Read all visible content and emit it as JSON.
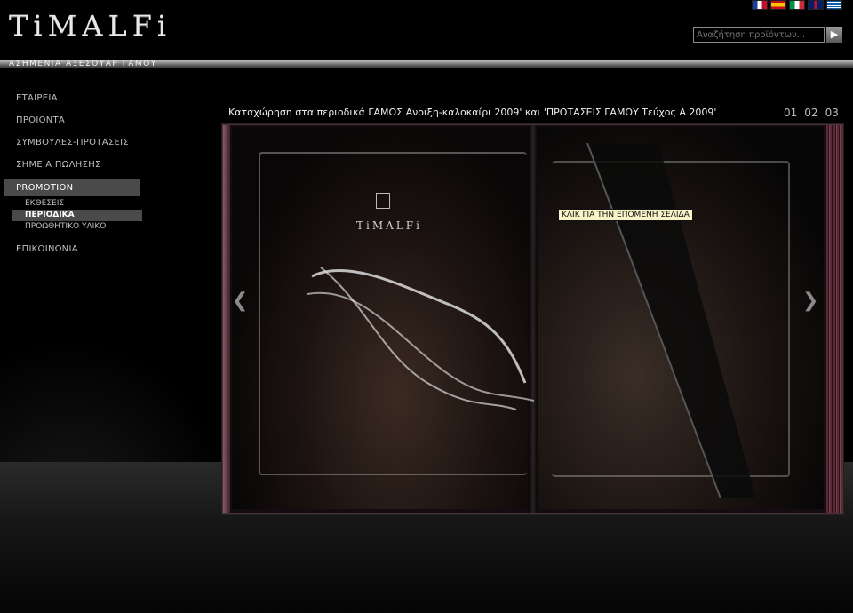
{
  "brand": {
    "logo_text": "TiMALFi",
    "tagline": "ΑΣΗΜΕΝΙΑ ΑΞΕΣΟΥΑΡ ΓΑΜΟΥ"
  },
  "flags": [
    {
      "name": "france-flag-icon",
      "colors": [
        "#1f3f9a",
        "#ffffff",
        "#c8102e"
      ]
    },
    {
      "name": "spain-flag-icon",
      "colors": [
        "#c60b1e",
        "#ffc400",
        "#c60b1e"
      ]
    },
    {
      "name": "italy-flag-icon",
      "colors": [
        "#009246",
        "#ffffff",
        "#ce2b37"
      ]
    },
    {
      "name": "uk-flag-icon",
      "colors": [
        "#012169",
        "#ffffff",
        "#c8102e"
      ]
    },
    {
      "name": "greece-flag-icon",
      "colors": [
        "#0d5eaf",
        "#ffffff",
        "#0d5eaf"
      ]
    }
  ],
  "search": {
    "placeholder": "Αναζήτηση προϊόντων..."
  },
  "nav": {
    "items": [
      "ΕΤΑΙΡΕΙΑ",
      "ΠΡΟΪΟΝΤΑ",
      "ΣΥΜΒΟΥΛΕΣ-ΠΡΟΤΑΣΕΙΣ",
      "ΣΗΜΕΙΑ ΠΩΛΗΣΗΣ"
    ],
    "active": "PROMOTION",
    "subitems": [
      "ΕΚΘΕΣΕΙΣ",
      "ΠΕΡΙΟΔΙΚΑ",
      "ΠΡΟΩΘΗΤΙΚΟ ΥΛΙΚΟ"
    ],
    "last": "ΕΠΙΚΟΙΝΩΝΙΑ"
  },
  "content": {
    "caption": "Καταχώρηση στα περιοδικά ΓΑΜΟΣ Ανοιξη-καλοκαίρι 2009' και 'ΠΡΟΤΑΣΕΙΣ ΓΑΜΟΥ Τεύχος Α 2009'",
    "pages": [
      "01",
      "02",
      "03"
    ],
    "book_logo": "TiMALFi",
    "tooltip": "ΚΛΙΚ ΓΙΑ ΤΗΝ ΕΠΟΜΕΝΗ ΣΕΛΙΔΑ",
    "prev_icon": "chevron-left-icon",
    "next_icon": "chevron-right-icon"
  },
  "colors": {
    "accent_active": "#4a4a4a",
    "tooltip_bg": "#f8f4c8"
  }
}
